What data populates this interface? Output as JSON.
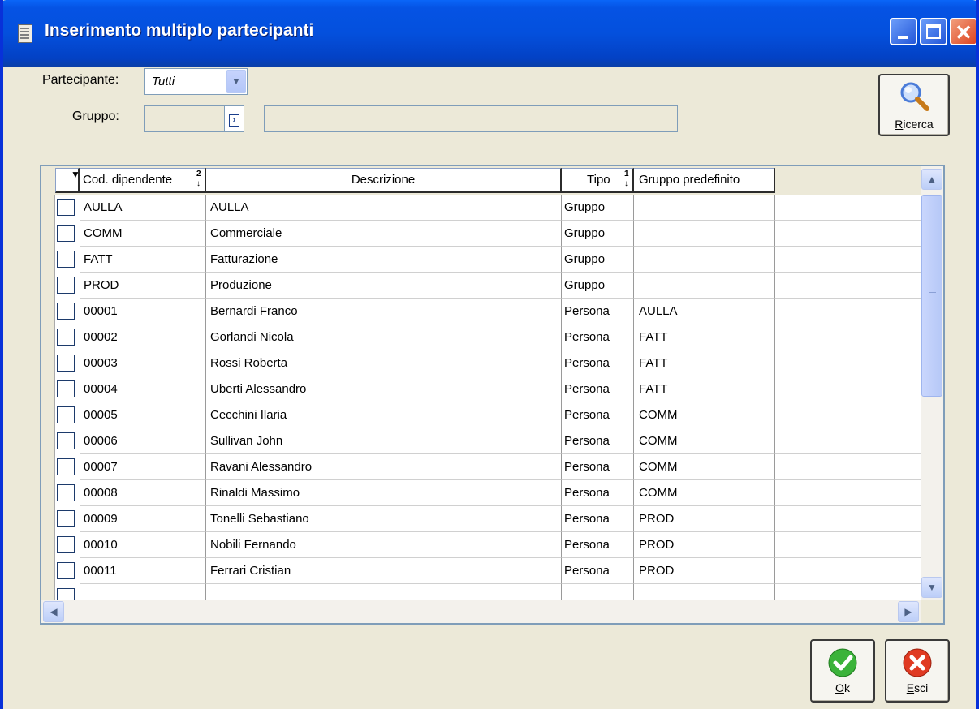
{
  "window": {
    "title": "Inserimento multiplo partecipanti"
  },
  "filters": {
    "partecipante_label": "Partecipante:",
    "partecipante_value": "Tutti",
    "gruppo_label": "Gruppo:",
    "gruppo_code": "",
    "gruppo_desc": ""
  },
  "buttons": {
    "ricerca": {
      "first": "R",
      "rest": "icerca"
    },
    "ok": {
      "first": "O",
      "rest": "k"
    },
    "esci": {
      "first": "E",
      "rest": "sci"
    }
  },
  "grid": {
    "columns": {
      "code": "Cod. dipendente",
      "code_sort": "2",
      "desc": "Descrizione",
      "type": "Tipo",
      "type_sort": "1",
      "group": "Gruppo predefinito"
    },
    "rows": [
      {
        "code": "AULLA",
        "desc": "AULLA",
        "type": "Gruppo",
        "group": ""
      },
      {
        "code": "COMM",
        "desc": "Commerciale",
        "type": "Gruppo",
        "group": ""
      },
      {
        "code": "FATT",
        "desc": "Fatturazione",
        "type": "Gruppo",
        "group": ""
      },
      {
        "code": "PROD",
        "desc": "Produzione",
        "type": "Gruppo",
        "group": ""
      },
      {
        "code": "00001",
        "desc": "Bernardi Franco",
        "type": "Persona",
        "group": "AULLA"
      },
      {
        "code": "00002",
        "desc": "Gorlandi Nicola",
        "type": "Persona",
        "group": "FATT"
      },
      {
        "code": "00003",
        "desc": "Rossi Roberta",
        "type": "Persona",
        "group": "FATT"
      },
      {
        "code": "00004",
        "desc": "Uberti Alessandro",
        "type": "Persona",
        "group": "FATT"
      },
      {
        "code": "00005",
        "desc": "Cecchini Ilaria",
        "type": "Persona",
        "group": "COMM"
      },
      {
        "code": "00006",
        "desc": "Sullivan John",
        "type": "Persona",
        "group": "COMM"
      },
      {
        "code": "00007",
        "desc": "Ravani Alessandro",
        "type": "Persona",
        "group": "COMM"
      },
      {
        "code": "00008",
        "desc": "Rinaldi Massimo",
        "type": "Persona",
        "group": "COMM"
      },
      {
        "code": "00009",
        "desc": "Tonelli Sebastiano",
        "type": "Persona",
        "group": "PROD"
      },
      {
        "code": "00010",
        "desc": "Nobili Fernando",
        "type": "Persona",
        "group": "PROD"
      },
      {
        "code": "00011",
        "desc": "Ferrari Cristian",
        "type": "Persona",
        "group": "PROD"
      },
      {
        "code": "",
        "desc": "",
        "type": "",
        "group": ""
      }
    ]
  },
  "colors": {
    "titlebar": "#0553e4",
    "ok_icon": "#3bb33a",
    "esci_icon": "#e03a22",
    "ricerca_icon": "#4a7bd8"
  }
}
